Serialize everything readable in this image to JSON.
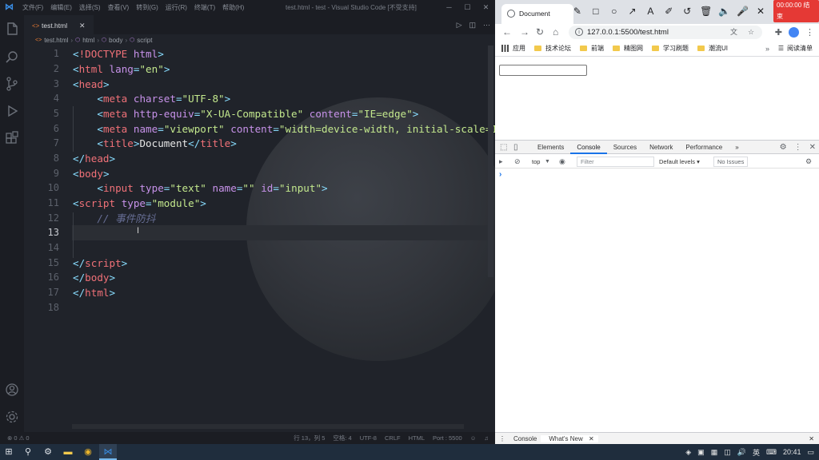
{
  "vscode": {
    "menu": [
      "文件(F)",
      "编辑(E)",
      "选择(S)",
      "查看(V)",
      "转到(G)",
      "运行(R)",
      "终端(T)",
      "帮助(H)"
    ],
    "window_title": "test.html - test - Visual Studio Code [不受支持]",
    "tab_label": "test.html",
    "breadcrumb": [
      "test.html",
      "html",
      "body",
      "script"
    ],
    "line_numbers": [
      "1",
      "2",
      "3",
      "4",
      "5",
      "6",
      "7",
      "8",
      "9",
      "10",
      "11",
      "12",
      "13",
      "14",
      "15",
      "16",
      "17",
      "18"
    ],
    "active_line": "13",
    "status_left": "⊗ 0 ⚠ 0",
    "status_right": [
      "行 13，列 5",
      "空格: 4",
      "UTF-8",
      "CRLF",
      "HTML",
      "Port : 5500"
    ]
  },
  "chrome": {
    "tab_title": "Document",
    "recording_label": "00:00:00 结束",
    "url": "127.0.0.1:5500/test.html",
    "bookmarks": [
      "应用",
      "技术论坛",
      "前端",
      "精图网",
      "学习刷题",
      "潮流UI"
    ],
    "reading_list": "阅读清单",
    "devtools_tabs": [
      "Elements",
      "Console",
      "Sources",
      "Network",
      "Performance"
    ],
    "devtools_selected": "Console",
    "context": "top",
    "filter_placeholder": "Filter",
    "levels": "Default levels",
    "issues": "No Issues",
    "drawer_tabs": [
      "Console",
      "What's New"
    ]
  },
  "taskbar": {
    "ime": "英",
    "time": "20:41"
  }
}
